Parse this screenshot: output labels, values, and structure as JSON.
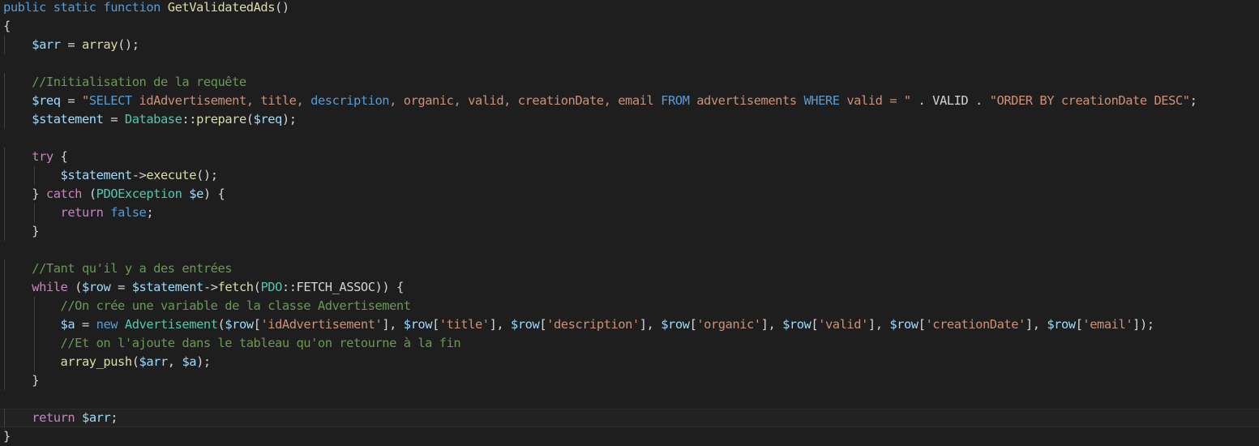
{
  "editor": {
    "language": "php",
    "theme_colors": {
      "background": "#1e1e1e",
      "keyword": "#569cd6",
      "control": "#c586c0",
      "function": "#dcdcaa",
      "variable": "#9cdcfe",
      "string": "#ce9178",
      "comment": "#6a9955",
      "type": "#4ec9b0",
      "text": "#d4d4d4"
    },
    "current_line": 22,
    "lines": [
      {
        "indent": 0,
        "tokens": [
          [
            "kw",
            "public static function "
          ],
          [
            "fn",
            "GetValidatedAds"
          ],
          [
            "punc",
            "()"
          ]
        ]
      },
      {
        "indent": 0,
        "tokens": [
          [
            "punc",
            "{"
          ]
        ]
      },
      {
        "indent": 1,
        "tokens": [
          [
            "var",
            "$arr"
          ],
          [
            "punc",
            " = "
          ],
          [
            "fn",
            "array"
          ],
          [
            "punc",
            "();"
          ]
        ]
      },
      {
        "indent": 0,
        "tokens": []
      },
      {
        "indent": 1,
        "tokens": [
          [
            "cmt",
            "//Initialisation de la requête"
          ]
        ]
      },
      {
        "indent": 1,
        "tokens": [
          [
            "var",
            "$req"
          ],
          [
            "punc",
            " = "
          ],
          [
            "str",
            "\""
          ],
          [
            "kw",
            "SELECT"
          ],
          [
            "str",
            " idAdvertisement, title, "
          ],
          [
            "kw",
            "description"
          ],
          [
            "str",
            ", organic, valid, creationDate, email "
          ],
          [
            "kw",
            "FROM"
          ],
          [
            "str",
            " advertisements "
          ],
          [
            "kw",
            "WHERE"
          ],
          [
            "str",
            " valid = \""
          ],
          [
            "punc",
            " . VALID . "
          ],
          [
            "str",
            "\"ORDER BY creationDate DESC\""
          ],
          [
            "punc",
            ";"
          ]
        ]
      },
      {
        "indent": 1,
        "tokens": [
          [
            "var",
            "$statement"
          ],
          [
            "punc",
            " = "
          ],
          [
            "type",
            "Database"
          ],
          [
            "punc",
            "::"
          ],
          [
            "fn",
            "prepare"
          ],
          [
            "punc",
            "("
          ],
          [
            "var",
            "$req"
          ],
          [
            "punc",
            ");"
          ]
        ]
      },
      {
        "indent": 0,
        "tokens": []
      },
      {
        "indent": 1,
        "tokens": [
          [
            "ctl",
            "try"
          ],
          [
            "punc",
            " {"
          ]
        ]
      },
      {
        "indent": 2,
        "tokens": [
          [
            "var",
            "$statement"
          ],
          [
            "punc",
            "->"
          ],
          [
            "fn",
            "execute"
          ],
          [
            "punc",
            "();"
          ]
        ]
      },
      {
        "indent": 1,
        "tokens": [
          [
            "punc",
            "} "
          ],
          [
            "ctl",
            "catch"
          ],
          [
            "punc",
            " ("
          ],
          [
            "type",
            "PDOException"
          ],
          [
            "punc",
            " "
          ],
          [
            "var",
            "$e"
          ],
          [
            "punc",
            ") {"
          ]
        ]
      },
      {
        "indent": 2,
        "tokens": [
          [
            "ctl",
            "return"
          ],
          [
            "punc",
            " "
          ],
          [
            "kw",
            "false"
          ],
          [
            "punc",
            ";"
          ]
        ]
      },
      {
        "indent": 1,
        "tokens": [
          [
            "punc",
            "}"
          ]
        ]
      },
      {
        "indent": 0,
        "tokens": []
      },
      {
        "indent": 1,
        "tokens": [
          [
            "cmt",
            "//Tant qu'il y a des entrées"
          ]
        ]
      },
      {
        "indent": 1,
        "tokens": [
          [
            "ctl",
            "while"
          ],
          [
            "punc",
            " ("
          ],
          [
            "var",
            "$row"
          ],
          [
            "punc",
            " = "
          ],
          [
            "var",
            "$statement"
          ],
          [
            "punc",
            "->"
          ],
          [
            "fn",
            "fetch"
          ],
          [
            "punc",
            "("
          ],
          [
            "type",
            "PDO"
          ],
          [
            "punc",
            "::FETCH_ASSOC)) {"
          ]
        ]
      },
      {
        "indent": 2,
        "tokens": [
          [
            "cmt",
            "//On crée une variable de la classe Advertisement"
          ]
        ]
      },
      {
        "indent": 2,
        "tokens": [
          [
            "var",
            "$a"
          ],
          [
            "punc",
            " = "
          ],
          [
            "kw",
            "new"
          ],
          [
            "punc",
            " "
          ],
          [
            "type",
            "Advertisement"
          ],
          [
            "punc",
            "("
          ],
          [
            "var",
            "$row"
          ],
          [
            "punc",
            "["
          ],
          [
            "str",
            "'idAdvertisement'"
          ],
          [
            "punc",
            "], "
          ],
          [
            "var",
            "$row"
          ],
          [
            "punc",
            "["
          ],
          [
            "str",
            "'title'"
          ],
          [
            "punc",
            "], "
          ],
          [
            "var",
            "$row"
          ],
          [
            "punc",
            "["
          ],
          [
            "str",
            "'description'"
          ],
          [
            "punc",
            "], "
          ],
          [
            "var",
            "$row"
          ],
          [
            "punc",
            "["
          ],
          [
            "str",
            "'organic'"
          ],
          [
            "punc",
            "], "
          ],
          [
            "var",
            "$row"
          ],
          [
            "punc",
            "["
          ],
          [
            "str",
            "'valid'"
          ],
          [
            "punc",
            "], "
          ],
          [
            "var",
            "$row"
          ],
          [
            "punc",
            "["
          ],
          [
            "str",
            "'creationDate'"
          ],
          [
            "punc",
            "], "
          ],
          [
            "var",
            "$row"
          ],
          [
            "punc",
            "["
          ],
          [
            "str",
            "'email'"
          ],
          [
            "punc",
            "]);"
          ]
        ]
      },
      {
        "indent": 2,
        "tokens": [
          [
            "cmt",
            "//Et on l'ajoute dans le tableau qu'on retourne à la fin"
          ]
        ]
      },
      {
        "indent": 2,
        "tokens": [
          [
            "fn",
            "array_push"
          ],
          [
            "punc",
            "("
          ],
          [
            "var",
            "$arr"
          ],
          [
            "punc",
            ", "
          ],
          [
            "var",
            "$a"
          ],
          [
            "punc",
            ");"
          ]
        ]
      },
      {
        "indent": 1,
        "tokens": [
          [
            "punc",
            "}"
          ]
        ]
      },
      {
        "indent": 0,
        "tokens": []
      },
      {
        "indent": 1,
        "tokens": [
          [
            "ctl",
            "return"
          ],
          [
            "punc",
            " "
          ],
          [
            "var",
            "$arr"
          ],
          [
            "punc",
            ";"
          ]
        ]
      },
      {
        "indent": 0,
        "tokens": [
          [
            "punc",
            "}"
          ]
        ]
      }
    ]
  }
}
